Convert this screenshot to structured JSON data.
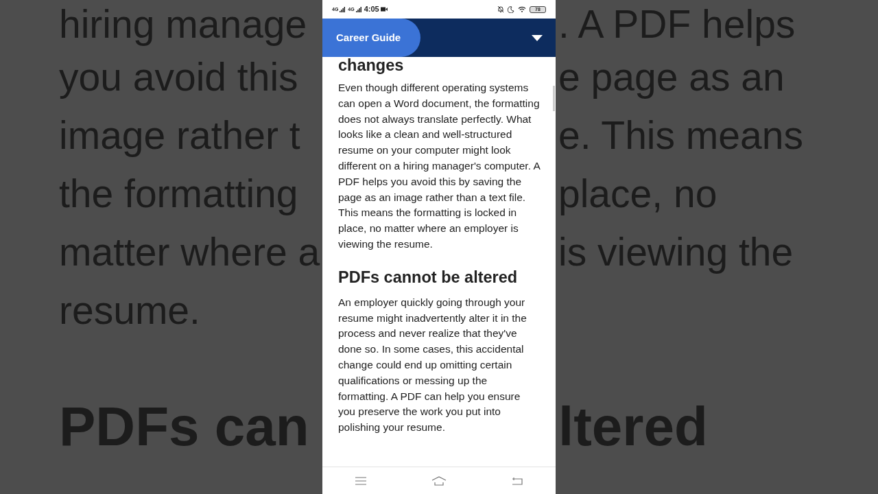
{
  "backdrop": {
    "left_lines": [
      "hiring manage",
      "you avoid this",
      "image rather t",
      "the formatting",
      "matter where a",
      "resume."
    ],
    "right_lines": [
      ". A PDF helps",
      "e page as an",
      "e. This means",
      "place, no",
      "is viewing the"
    ],
    "left_heading": "PDFs can",
    "right_heading": "ltered"
  },
  "status_bar": {
    "network_1": "4G",
    "network_2": "4G",
    "time": "4:05",
    "battery": "78"
  },
  "header": {
    "title": "Career Guide"
  },
  "article": [
    {
      "kind": "heading",
      "text": "changes"
    },
    {
      "kind": "paragraph",
      "text": "Even though different operating systems can open a Word document, the formatting does not always translate perfectly. What looks like a clean and well-structured resume on your computer might look different on a hiring manager's computer. A PDF helps you avoid this by saving the page as an image rather than a text file. This means the formatting is locked in place, no matter where an employer is viewing the resume."
    },
    {
      "kind": "heading",
      "text": "PDFs cannot be altered"
    },
    {
      "kind": "paragraph",
      "text": "An employer quickly going through your resume might inadvertently alter it in the process and never realize that they've done so. In some cases, this accidental change could end up omitting certain qualifications or messing up the formatting. A PDF can help you ensure you preserve the work you put into polishing your resume."
    }
  ]
}
